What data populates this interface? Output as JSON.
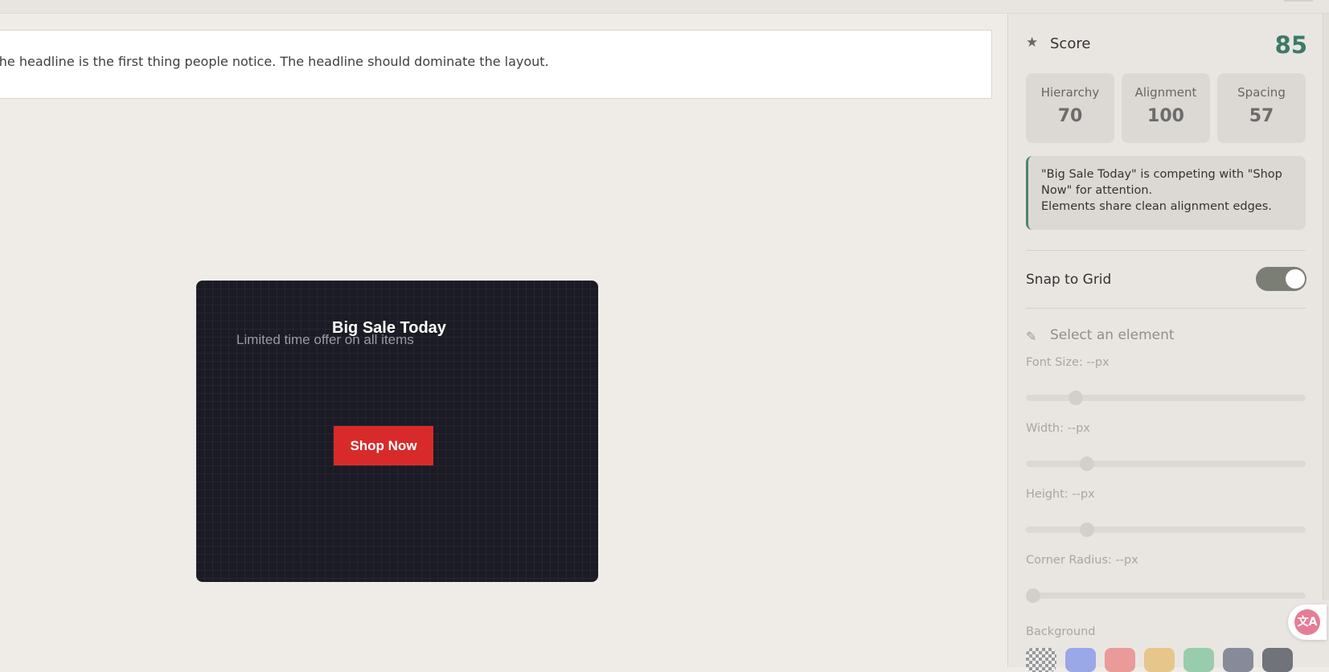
{
  "instruction": {
    "text": "The headline is the first thing people notice. The headline should dominate the layout."
  },
  "design": {
    "headline": "Big Sale Today",
    "subtext": "Limited time offer on all items",
    "cta": "Shop Now",
    "background_color": "#1b1b25",
    "cta_color": "#d82a2a"
  },
  "score": {
    "label": "Score",
    "value": "85",
    "icon": "star-icon",
    "metrics": [
      {
        "label": "Hierarchy",
        "value": "70"
      },
      {
        "label": "Alignment",
        "value": "100"
      },
      {
        "label": "Spacing",
        "value": "57"
      }
    ],
    "feedback": [
      "\"Big Sale Today\" is competing with \"Shop Now\" for attention.",
      "Elements share clean alignment edges."
    ]
  },
  "snap_to_grid": {
    "label": "Snap to Grid",
    "enabled": true
  },
  "properties": {
    "header": "Select an element",
    "header_icon": "pencil-icon",
    "font_size_label": "Font Size: --px",
    "width_label": "Width: --px",
    "height_label": "Height: --px",
    "corner_radius_label": "Corner Radius: --px",
    "background_label": "Background",
    "swatches": [
      "transparent",
      "#9aa8e8",
      "#ea9a98",
      "#e6c68a",
      "#98ccac",
      "#878a99",
      "#71737a"
    ]
  },
  "colors": {
    "accent": "#3c7a68",
    "toggle_on": "#7b7e74"
  }
}
